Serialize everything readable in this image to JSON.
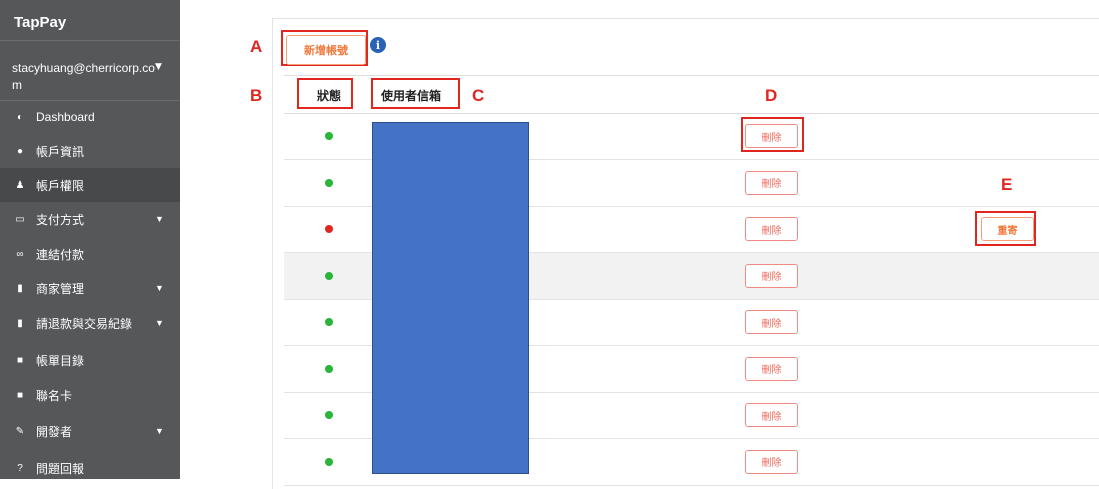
{
  "sidebar": {
    "brand": "TapPay",
    "user_email": "stacyhuang@cherricorp.com",
    "items": [
      {
        "label": "Dashboard",
        "icon": "dashboard-icon",
        "glyph": "◐"
      },
      {
        "label": "帳戶資訊",
        "icon": "info-icon",
        "glyph": "●"
      },
      {
        "label": "帳戶權限",
        "icon": "users-icon",
        "glyph": "♟",
        "active": true
      },
      {
        "label": "支付方式",
        "icon": "card-icon",
        "glyph": "▭",
        "caret": true
      },
      {
        "label": "連結付款",
        "icon": "link-icon",
        "glyph": "∞"
      },
      {
        "label": "商家管理",
        "icon": "chart-icon",
        "glyph": "▮",
        "caret": true
      },
      {
        "label": "請退款與交易紀錄",
        "icon": "chart-icon",
        "glyph": "▮",
        "caret": true
      },
      {
        "label": "帳單目錄",
        "icon": "book-icon",
        "glyph": "■"
      },
      {
        "label": "聯名卡",
        "icon": "book-icon",
        "glyph": "■"
      },
      {
        "label": "開發者",
        "icon": "wrench-icon",
        "glyph": "✎",
        "caret": true
      },
      {
        "label": "問題回報",
        "icon": "question-icon",
        "glyph": "?"
      }
    ]
  },
  "main": {
    "add_button": "新增帳號",
    "table": {
      "headers": {
        "status": "狀態",
        "email": "使用者信箱"
      },
      "delete_label": "刪除",
      "resend_label": "重寄",
      "rows": [
        {
          "status": "active"
        },
        {
          "status": "active"
        },
        {
          "status": "pending",
          "resend": true
        },
        {
          "status": "active"
        },
        {
          "status": "active"
        },
        {
          "status": "active"
        },
        {
          "status": "active"
        },
        {
          "status": "active"
        }
      ]
    }
  },
  "annotations": {
    "a": "A",
    "b": "B",
    "c": "C",
    "d": "D",
    "e": "E"
  },
  "colors": {
    "active": "#27b53a",
    "pending": "#e0261f",
    "accent": "#f07a3f",
    "annotation": "#e0261f",
    "mask": "#4472c4"
  }
}
